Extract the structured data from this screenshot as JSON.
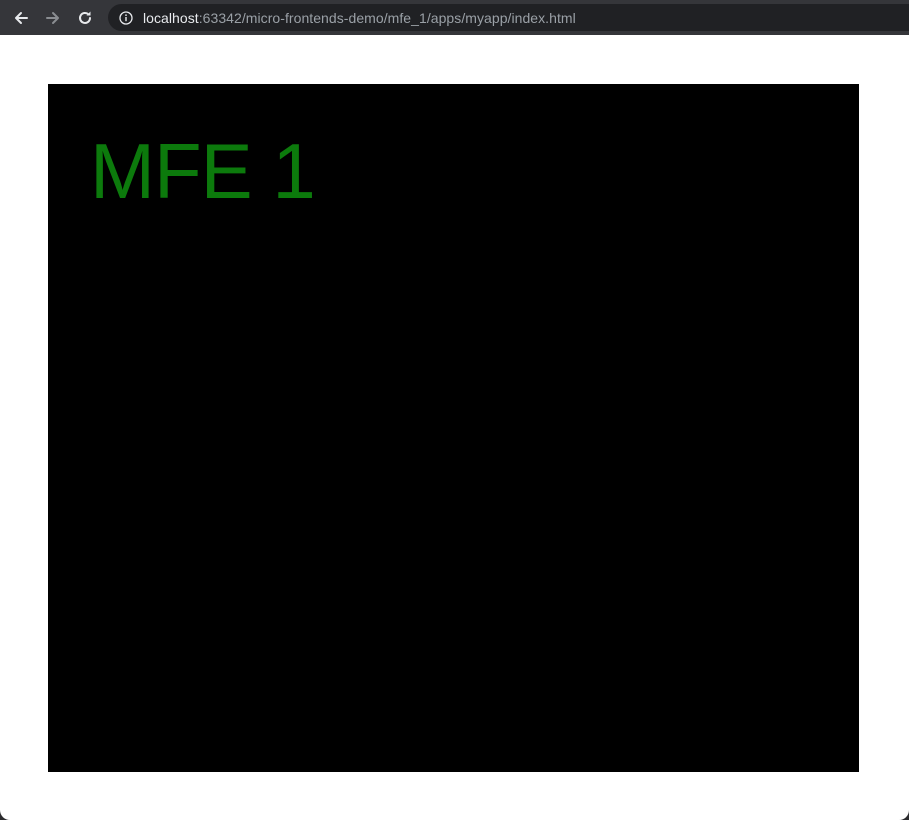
{
  "browser": {
    "url_host": "localhost",
    "url_rest": ":63342/micro-frontends-demo/mfe_1/apps/myapp/index.html",
    "icons": {
      "back": "arrow-left-icon",
      "forward": "arrow-right-icon",
      "reload": "reload-icon",
      "site_info": "info-icon"
    }
  },
  "page": {
    "title": "MFE 1",
    "colors": {
      "background": "#000000",
      "title": "#0c7a0c"
    }
  }
}
